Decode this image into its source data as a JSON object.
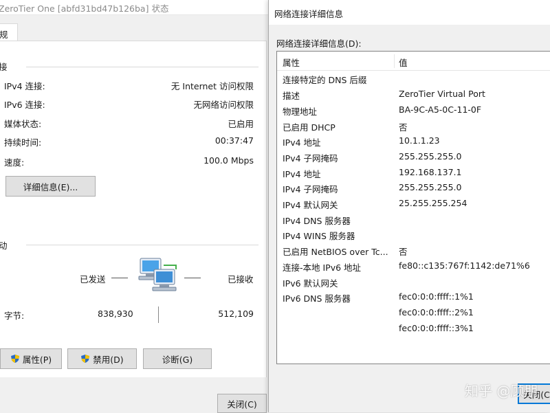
{
  "status_window": {
    "title": "ZeroTier One [abfd31bd47b126ba] 状态",
    "tab": "规",
    "connection_group": "接",
    "rows": [
      {
        "label": "IPv4 连接:",
        "value": "无 Internet 访问权限"
      },
      {
        "label": "IPv6 连接:",
        "value": "无网络访问权限"
      },
      {
        "label": "媒体状态:",
        "value": "已启用"
      },
      {
        "label": "持续时间:",
        "value": "00:37:47"
      },
      {
        "label": "速度:",
        "value": "100.0 Mbps"
      }
    ],
    "details_button": "详细信息(E)...",
    "activity_group": "动",
    "sent_label": "已发送",
    "received_label": "已接收",
    "bytes_label": "字节:",
    "bytes_sent": "838,930",
    "bytes_received": "512,109",
    "properties_button": "属性(P)",
    "disable_button": "禁用(D)",
    "diagnose_button": "诊断(G)",
    "close_button": "关闭(C)"
  },
  "details_dialog": {
    "title": "网络连接详细信息",
    "list_label": "网络连接详细信息(D):",
    "col_property": "属性",
    "col_value": "值",
    "rows": [
      {
        "prop": "连接特定的 DNS 后缀",
        "val": ""
      },
      {
        "prop": "描述",
        "val": "ZeroTier Virtual Port"
      },
      {
        "prop": "物理地址",
        "val": "BA-9C-A5-0C-11-0F"
      },
      {
        "prop": "已启用 DHCP",
        "val": "否"
      },
      {
        "prop": "IPv4 地址",
        "val": "10.1.1.23"
      },
      {
        "prop": "IPv4 子网掩码",
        "val": "255.255.255.0"
      },
      {
        "prop": "IPv4 地址",
        "val": "192.168.137.1"
      },
      {
        "prop": "IPv4 子网掩码",
        "val": "255.255.255.0"
      },
      {
        "prop": "IPv4 默认网关",
        "val": "25.255.255.254"
      },
      {
        "prop": "IPv4 DNS 服务器",
        "val": ""
      },
      {
        "prop": "IPv4 WINS 服务器",
        "val": ""
      },
      {
        "prop": "已启用 NetBIOS over Tc...",
        "val": "否"
      },
      {
        "prop": "连接-本地 IPv6 地址",
        "val": "fe80::c135:767f:1142:de71%6"
      },
      {
        "prop": "IPv6 默认网关",
        "val": ""
      },
      {
        "prop": "IPv6 DNS 服务器",
        "val": "fec0:0:0:ffff::1%1"
      },
      {
        "prop": "",
        "val": "fec0:0:0:ffff::2%1"
      },
      {
        "prop": "",
        "val": "fec0:0:0:ffff::3%1"
      }
    ],
    "close_button": "关闭(C)"
  },
  "watermark": "知乎 @顾朋",
  "colors": {
    "shield_blue": "#2b6cc4",
    "shield_yellow": "#f2c200"
  }
}
